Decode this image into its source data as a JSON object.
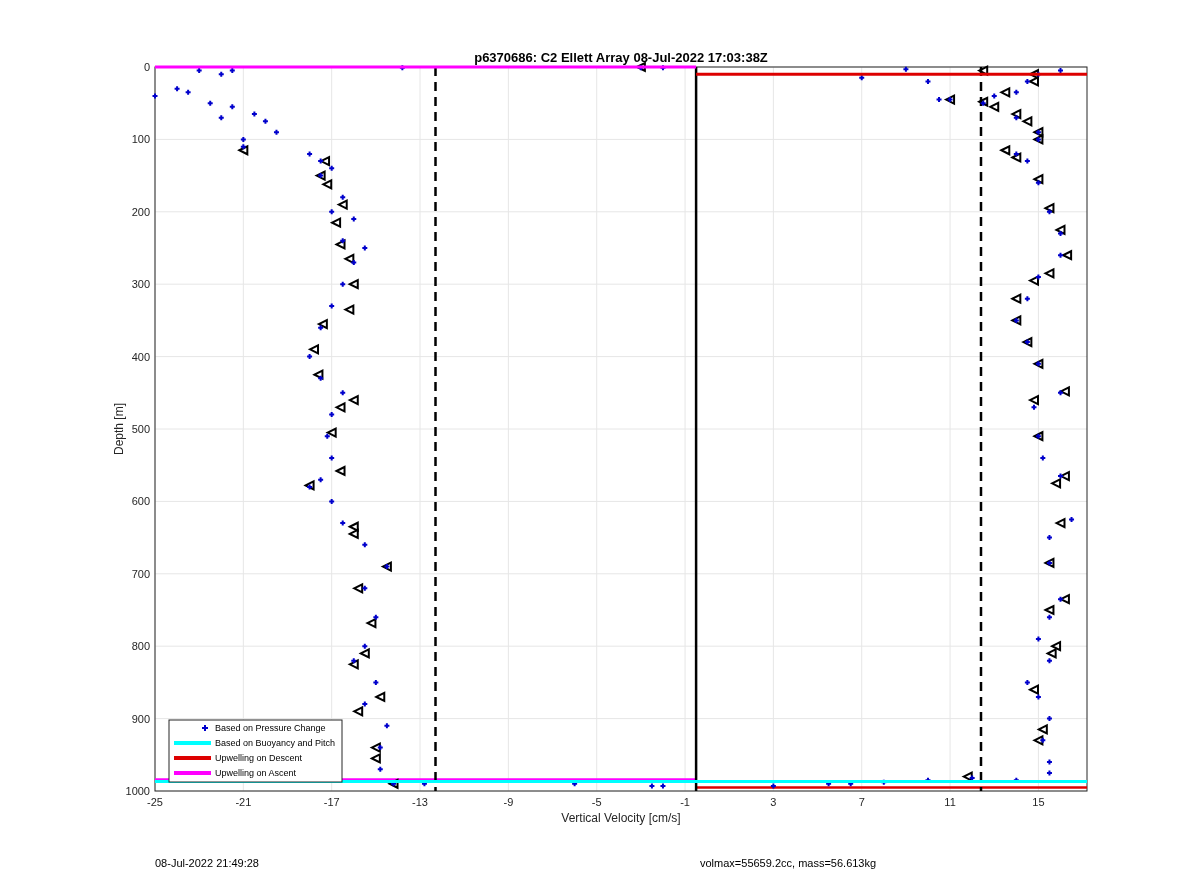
{
  "figure": {
    "footer_left": "08-Jul-2022 21:49:28",
    "footer_right": "volmax=55659.2cc, mass=56.613kg",
    "chart_data": {
      "type": "scatter",
      "title": "p6370686: C2 Ellett Array 08-Jul-2022 17:03:38Z",
      "xlabel": "Vertical Velocity [cm/s]",
      "ylabel": "Depth [m]",
      "xlim": [
        -25,
        17.2
      ],
      "ylim": [
        1000,
        0
      ],
      "xticks": [
        -25,
        -21,
        -17,
        -13,
        -9,
        -5,
        -1,
        3,
        7,
        11,
        15
      ],
      "yticks": [
        0,
        100,
        200,
        300,
        400,
        500,
        600,
        700,
        800,
        900,
        1000
      ],
      "series": [
        {
          "name": "Based on Pressure Change",
          "color": "#0000cc",
          "marker": "cross",
          "x": [
            -23,
            -22,
            -21.5,
            -24,
            -25,
            -23.5,
            -22.5,
            -21.5,
            -22,
            -20.5,
            -20,
            -21,
            -19.5,
            -21,
            -18,
            -17.5,
            -17,
            -17.5,
            -16.5,
            -17,
            -16,
            -16.5,
            -15.5,
            -16,
            -16.5,
            -17,
            -17.5,
            -18,
            -17.5,
            -16.5,
            -17,
            -17.2,
            -17,
            -17.5,
            -18,
            -17,
            -16.5,
            -15.5,
            -14.5,
            -15.5,
            -15,
            -15.5,
            -16,
            -15,
            -15.5,
            -14.5,
            -14.8,
            -14.8,
            -14.2,
            -12.8,
            -6,
            -2.5,
            -2,
            -13.8,
            -3,
            -2,
            10.5,
            11,
            12.5,
            13,
            14,
            15,
            14.5,
            16,
            14,
            15,
            15,
            14,
            14.5,
            15,
            15.5,
            16,
            16,
            15,
            14.5,
            14,
            14.5,
            15,
            16,
            14.8,
            15,
            15.2,
            16,
            16.5,
            15.5,
            15.5,
            16,
            15.5,
            15,
            15.5,
            14.5,
            15,
            15.5,
            15.2,
            15.5,
            15.5,
            14,
            12,
            10,
            8,
            6.5,
            5.5,
            3,
            7,
            9,
            10
          ],
          "values": [
            5,
            10,
            5,
            30,
            40,
            35,
            50,
            55,
            70,
            65,
            75,
            100,
            90,
            110,
            120,
            130,
            140,
            150,
            180,
            200,
            210,
            240,
            250,
            270,
            300,
            330,
            360,
            400,
            430,
            450,
            480,
            510,
            540,
            570,
            580,
            600,
            630,
            660,
            690,
            720,
            760,
            800,
            820,
            850,
            880,
            910,
            940,
            970,
            990,
            990,
            990,
            993,
            993,
            1,
            1,
            1,
            45,
            45,
            50,
            40,
            35,
            10,
            20,
            5,
            70,
            90,
            100,
            120,
            130,
            160,
            200,
            230,
            260,
            290,
            320,
            350,
            380,
            410,
            450,
            470,
            510,
            540,
            565,
            625,
            650,
            685,
            735,
            760,
            790,
            820,
            850,
            870,
            900,
            930,
            960,
            975,
            985,
            982,
            985,
            988,
            990,
            990,
            993,
            15,
            3,
            20
          ]
        },
        {
          "color": "#000000",
          "marker": "triangle",
          "x": [
            -21,
            -17.3,
            -17.5,
            -17.2,
            -16.5,
            -16.8,
            -16.6,
            -16.2,
            -16,
            -16.2,
            -17.4,
            -17.8,
            -17.6,
            -16,
            -16.6,
            -17,
            -16.6,
            -18,
            -16,
            -16,
            -14.5,
            -15.8,
            -15.2,
            -15.5,
            -16,
            -14.8,
            -15.8,
            -15,
            -15,
            -14.2,
            -3,
            12.5,
            14.8,
            14.8,
            13.5,
            11,
            12.5,
            13,
            14,
            14.5,
            15,
            15,
            13.5,
            14,
            15,
            15.5,
            16,
            16.3,
            15.5,
            14.8,
            14,
            14,
            14.5,
            15,
            16.2,
            14.8,
            15,
            16.2,
            15.8,
            16,
            15.5,
            16.2,
            15.5,
            15.8,
            15.6,
            14.8,
            15.2,
            15,
            11.8
          ],
          "values": [
            115,
            130,
            150,
            162,
            190,
            215,
            245,
            265,
            300,
            335,
            355,
            390,
            425,
            460,
            470,
            505,
            558,
            578,
            635,
            645,
            690,
            720,
            768,
            810,
            825,
            870,
            890,
            940,
            955,
            990,
            0,
            5,
            10,
            20,
            35,
            45,
            48,
            55,
            65,
            75,
            90,
            100,
            115,
            125,
            155,
            195,
            225,
            260,
            285,
            295,
            320,
            350,
            380,
            410,
            448,
            460,
            510,
            565,
            575,
            630,
            685,
            735,
            750,
            800,
            810,
            860,
            915,
            930,
            980
          ]
        },
        {
          "name": "Based on Buoyancy and Pitch",
          "type": "line",
          "color": "#00ffff",
          "x": [
            -25,
            17.2
          ],
          "values": [
            987,
            987
          ]
        },
        {
          "name": "Upwelling on Descent",
          "type": "line",
          "color": "#dd0000",
          "x": [
            -0.5,
            17.2
          ],
          "values": [
            10,
            10
          ]
        },
        {
          "type": "line",
          "color": "#dd0000",
          "x": [
            -0.5,
            17.2
          ],
          "values": [
            995,
            995
          ]
        },
        {
          "name": "Upwelling on Ascent",
          "type": "line",
          "color": "#ff00ff",
          "x": [
            -25,
            -0.5
          ],
          "values": [
            0,
            0
          ]
        },
        {
          "type": "line",
          "color": "#ff00ff",
          "x": [
            -25,
            -0.5
          ],
          "values": [
            984,
            984
          ]
        },
        {
          "type": "line",
          "color": "#000000",
          "x": [
            -0.5,
            -0.5
          ],
          "values": [
            0,
            1000
          ]
        },
        {
          "type": "line",
          "line_style": "dashed",
          "color": "#000000",
          "x": [
            -12.3,
            -12.3
          ],
          "values": [
            0,
            1000
          ]
        },
        {
          "type": "line",
          "line_style": "dashed",
          "color": "#000000",
          "x": [
            12.4,
            12.4
          ],
          "values": [
            0,
            1000
          ]
        }
      ],
      "grid": true,
      "legend": true
    }
  }
}
